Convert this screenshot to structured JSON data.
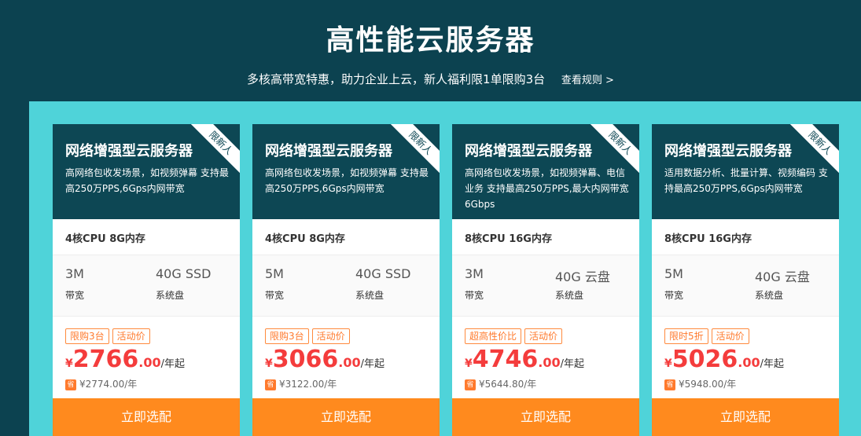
{
  "hero": {
    "title": "高性能云服务器",
    "subtitle": "多核高带宽特惠，助力企业上云，新人福利限1单限购3台",
    "rules_link": "查看规则 >"
  },
  "colors": {
    "hero_bg": "#0c4250",
    "panel_bg": "#4fd3d9",
    "card_head_bg": "#0d4754",
    "price_red": "#f43c3c",
    "button_orange": "#ff8a1e",
    "tag_orange": "#ff7a2d"
  },
  "cards": [
    {
      "title": "网络增强型云服务器",
      "ribbon": "限新人",
      "desc": "高网络包收发场景，如视频弹幕 支持最高250万PPS,6Gps内网带宽",
      "spec": "4核CPU 8G内存",
      "bandwidth_value": "3M",
      "bandwidth_label": "带宽",
      "disk_value": "40G SSD",
      "disk_label": "系统盘",
      "tag1": "限购3台",
      "tag2": "活动价",
      "currency": "¥",
      "price_int": "2766",
      "price_dec": ".00",
      "price_unit": "/年起",
      "save_icon": "省",
      "old_price": "¥2774.00/年",
      "button": "立即选配"
    },
    {
      "title": "网络增强型云服务器",
      "ribbon": "限新人",
      "desc": "高网络包收发场景，如视频弹幕 支持最高250万PPS,6Gps内网带宽",
      "spec": "4核CPU 8G内存",
      "bandwidth_value": "5M",
      "bandwidth_label": "带宽",
      "disk_value": "40G SSD",
      "disk_label": "系统盘",
      "tag1": "限购3台",
      "tag2": "活动价",
      "currency": "¥",
      "price_int": "3066",
      "price_dec": ".00",
      "price_unit": "/年起",
      "save_icon": "省",
      "old_price": "¥3122.00/年",
      "button": "立即选配"
    },
    {
      "title": "网络增强型云服务器",
      "ribbon": "限新人",
      "desc": "高网络包收发场景，如视频弹幕、电信业务 支持最高250万PPS,最大内网带宽 6Gbps",
      "spec": "8核CPU 16G内存",
      "bandwidth_value": "3M",
      "bandwidth_label": "带宽",
      "disk_value": "40G 云盘",
      "disk_label": "系统盘",
      "tag1": "超高性价比",
      "tag2": "活动价",
      "currency": "¥",
      "price_int": "4746",
      "price_dec": ".00",
      "price_unit": "/年起",
      "save_icon": "省",
      "old_price": "¥5644.80/年",
      "button": "立即选配"
    },
    {
      "title": "网络增强型云服务器",
      "ribbon": "限新人",
      "desc": "适用数据分析、批量计算、视频编码 支持最高250万PPS,6Gps内网带宽",
      "spec": "8核CPU 16G内存",
      "bandwidth_value": "5M",
      "bandwidth_label": "带宽",
      "disk_value": "40G 云盘",
      "disk_label": "系统盘",
      "tag1": "限时5折",
      "tag2": "活动价",
      "currency": "¥",
      "price_int": "5026",
      "price_dec": ".00",
      "price_unit": "/年起",
      "save_icon": "省",
      "old_price": "¥5948.00/年",
      "button": "立即选配"
    }
  ]
}
